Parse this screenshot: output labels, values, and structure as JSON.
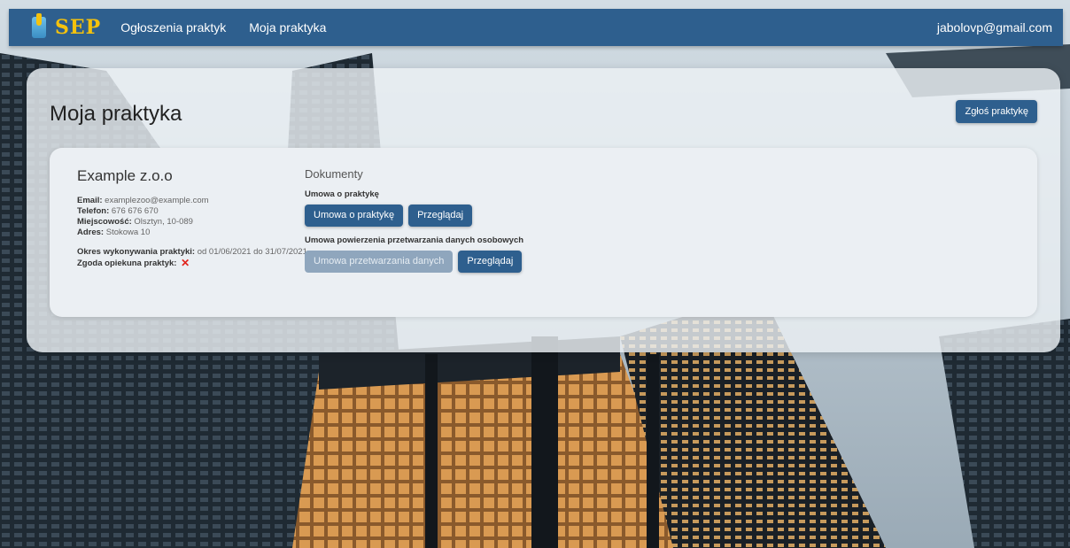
{
  "nav": {
    "logo_text": "SEP",
    "links": [
      "Ogłoszenia praktyk",
      "Moja praktyka"
    ],
    "user_email": "jabolovp@gmail.com"
  },
  "page": {
    "title": "Moja praktyka",
    "report_button": "Zgłoś praktykę"
  },
  "company": {
    "name": "Example z.o.o",
    "email_label": "Email:",
    "email": "examplezoo@example.com",
    "phone_label": "Telefon:",
    "phone": "676 676 670",
    "city_label": "Miejscowość:",
    "city": "Olsztyn, 10-089",
    "address_label": "Adres:",
    "address": "Stokowa 10",
    "period_label": "Okres wykonywania praktyki:",
    "period": "od 01/06/2021 do 31/07/2021",
    "consent_label": "Zgoda opiekuna praktyk:",
    "consent_icon": "cross-icon",
    "consent_color": "#e0221b"
  },
  "documents": {
    "title": "Dokumenty",
    "sections": [
      {
        "label": "Umowa o praktykę",
        "primary_button": "Umowa o praktykę",
        "browse_button": "Przeglądaj"
      },
      {
        "label": "Umowa powierzenia przetwarzania danych osobowych",
        "primary_button": "Umowa przetwarzania danych",
        "browse_button": "Przeglądaj"
      }
    ]
  },
  "colors": {
    "primary": "#2e5f8e",
    "logo": "#f4c20d",
    "disabled": "#8fa6bd"
  }
}
